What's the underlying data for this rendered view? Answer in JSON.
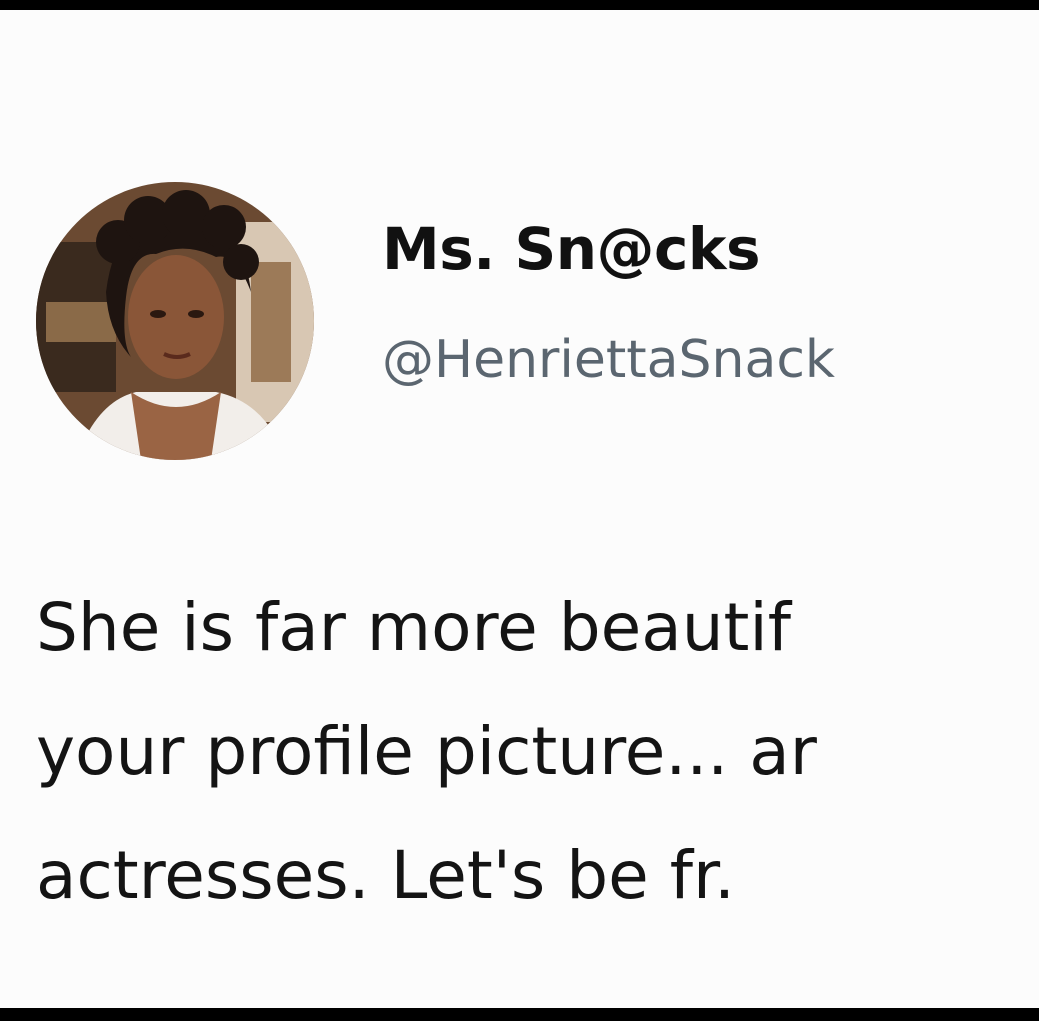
{
  "tweet": {
    "author": {
      "display_name": "Ms. Sn@cks",
      "handle": "@HenriettaSnack"
    },
    "text_lines": [
      "She is far more beautif",
      "your profile picture... ar",
      "actresses. Let's be fr."
    ]
  },
  "colors": {
    "background": "#fcfcfc",
    "text": "#141414",
    "handle": "#5b6670",
    "border": "#000000"
  }
}
